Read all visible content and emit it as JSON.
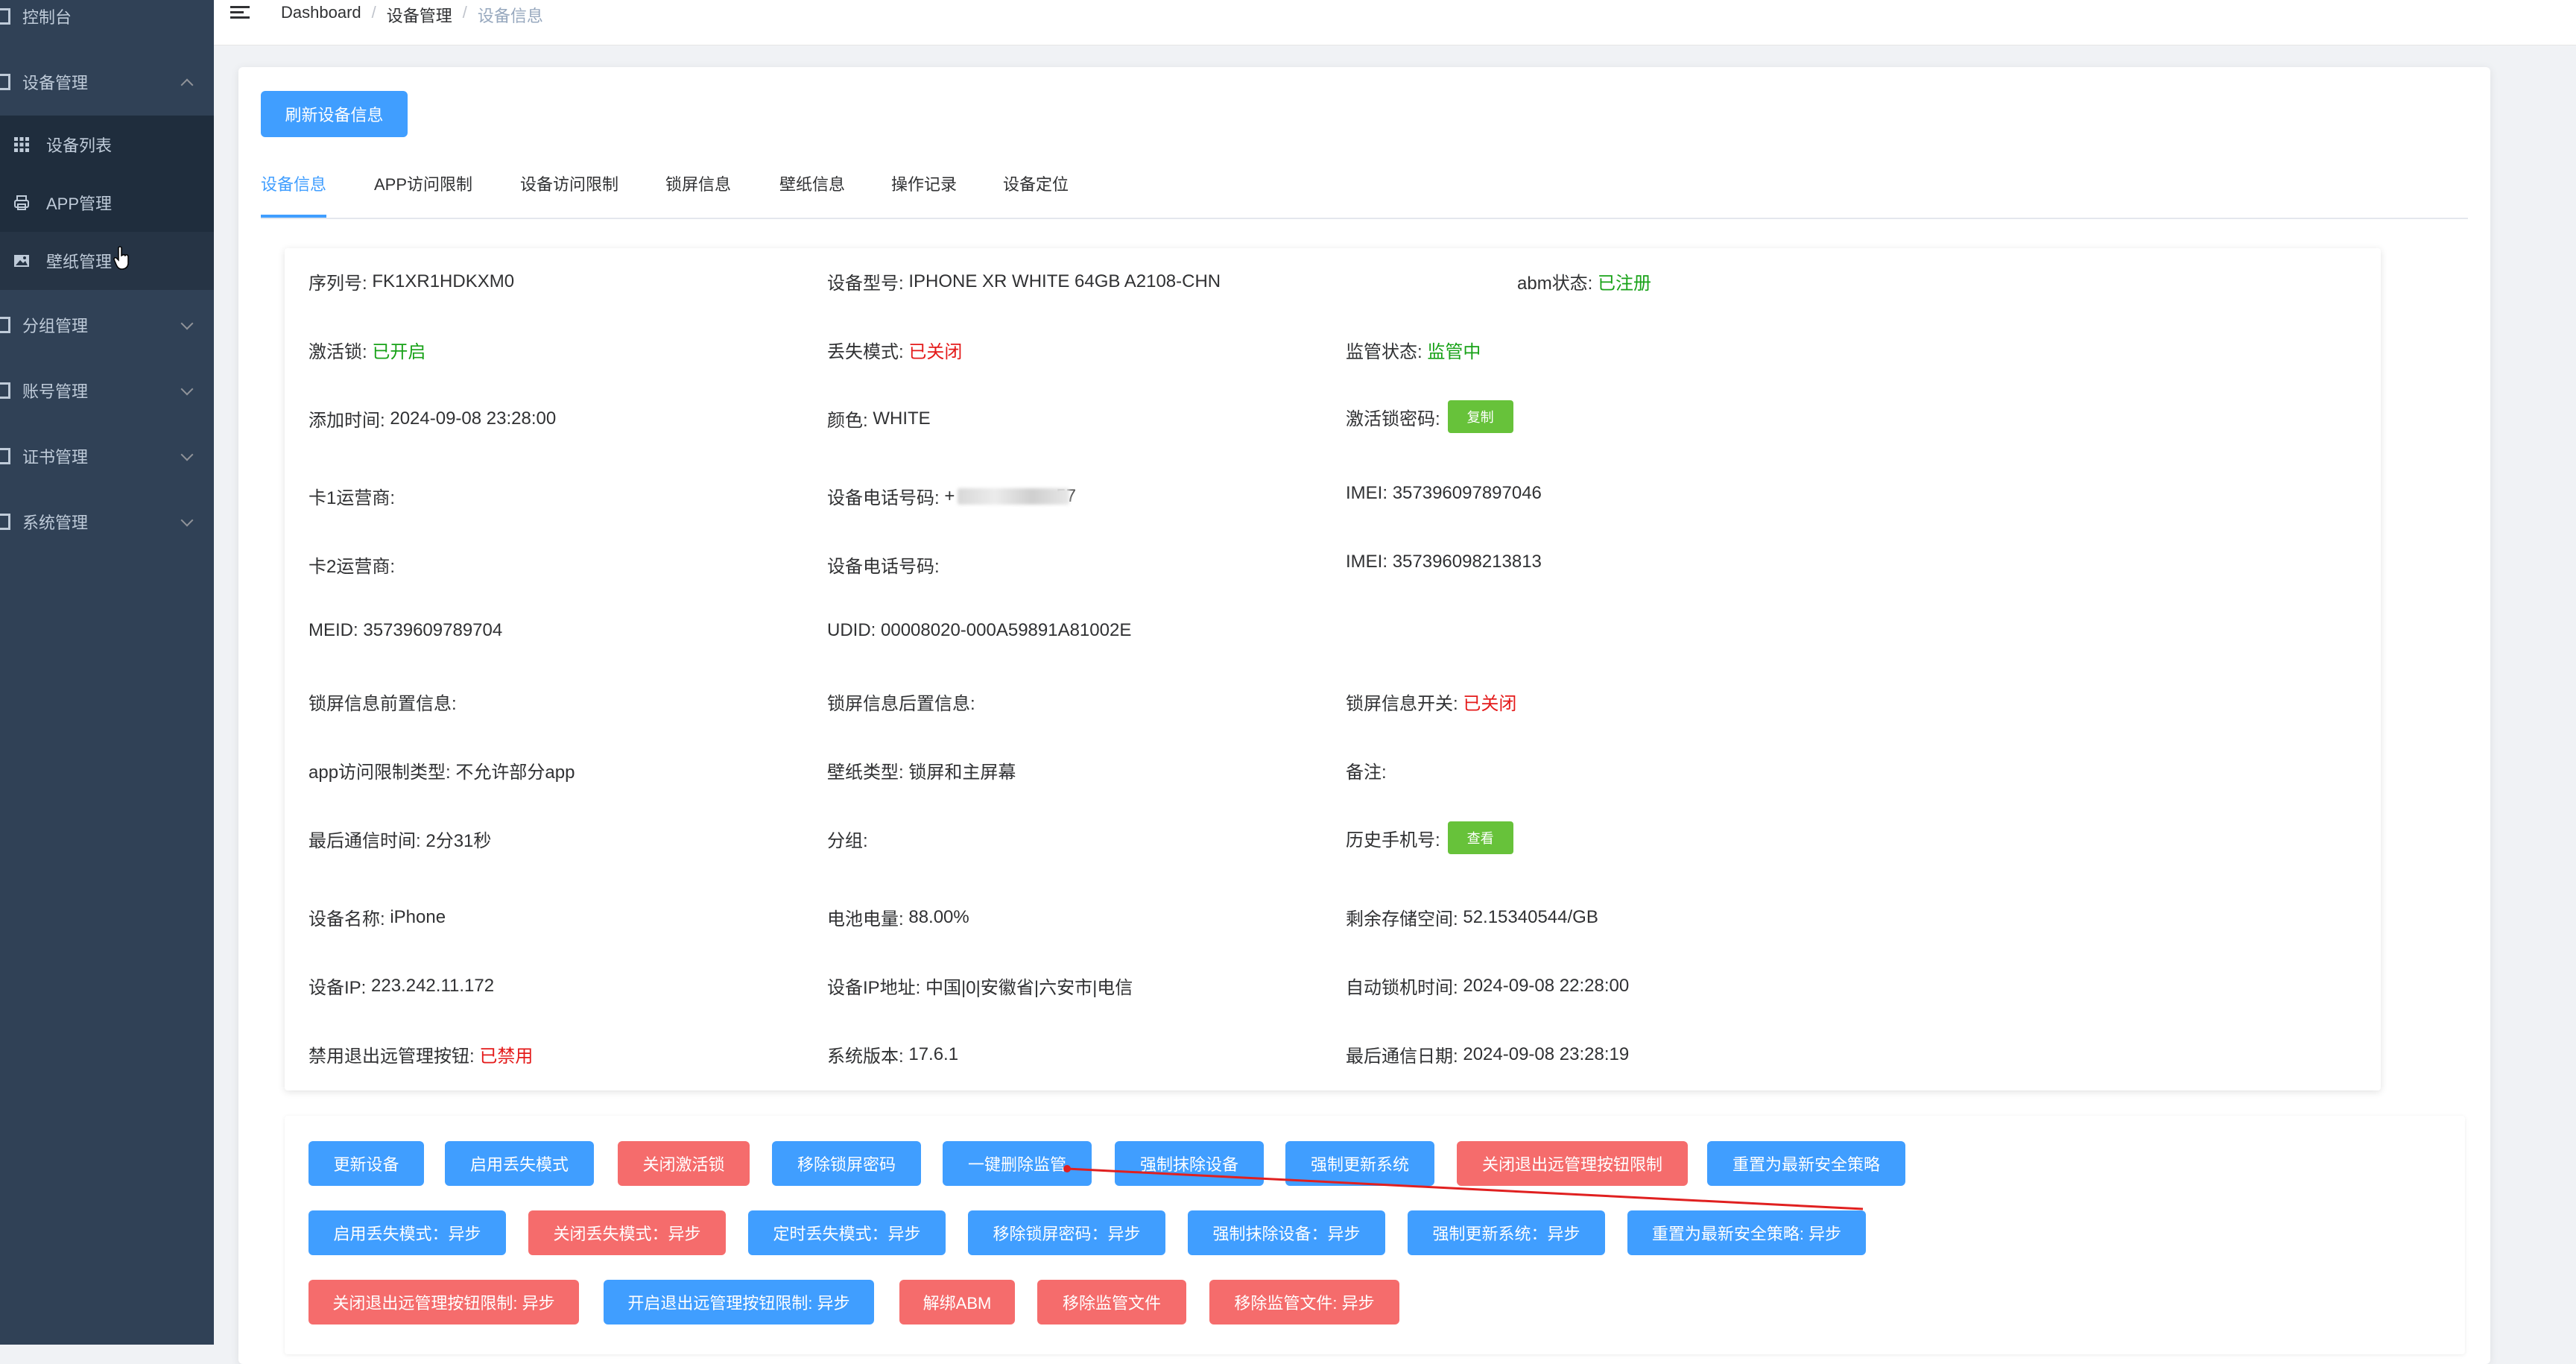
{
  "sidebar": {
    "dashboard": "控制台",
    "device_mgmt": "设备管理",
    "device_list": "设备列表",
    "app_mgmt": "APP管理",
    "wallpaper_mgmt": "壁纸管理",
    "group_mgmt": "分组管理",
    "account_mgmt": "账号管理",
    "cert_mgmt": "证书管理",
    "system_mgmt": "系统管理"
  },
  "breadcrumb": {
    "root": "Dashboard",
    "sep": "/",
    "parent": "设备管理",
    "current": "设备信息"
  },
  "toolbar": {
    "refresh_label": "刷新设备信息"
  },
  "tabs": [
    "设备信息",
    "APP访问限制",
    "设备访问限制",
    "锁屏信息",
    "壁纸信息",
    "操作记录",
    "设备定位"
  ],
  "info": {
    "serial_label": "序列号:",
    "serial": "FK1XR1HDKXM0",
    "model_label": "设备型号:",
    "model": "IPHONE XR WHITE 64GB A2108-CHN",
    "abm_label": "abm状态:",
    "abm": "已注册",
    "activation_lock_label": "激活锁:",
    "activation_lock": "已开启",
    "lost_mode_label": "丢失模式:",
    "lost_mode": "已关闭",
    "supervise_label": "监管状态:",
    "supervise": "监管中",
    "added_label": "添加时间:",
    "added": "2024-09-08 23:28:00",
    "color_label": "颜色:",
    "color": "WHITE",
    "al_code_label": "激活锁密码:",
    "copy_btn": "复制",
    "carrier1_label": "卡1运营商:",
    "phone1_label": "设备电话号码:",
    "phone1_prefix": "+",
    "phone1_suffix": "57",
    "imei1_label": "IMEI:",
    "imei1": "357396097897046",
    "carrier2_label": "卡2运营商:",
    "phone2_label": "设备电话号码:",
    "imei2_label": "IMEI:",
    "imei2": "357396098213813",
    "meid_label": "MEID:",
    "meid": "35739609789704",
    "udid_label": "UDID:",
    "udid": "00008020-000A59891A81002E",
    "lock_front_label": "锁屏信息前置信息:",
    "lock_back_label": "锁屏信息后置信息:",
    "lock_switch_label": "锁屏信息开关:",
    "lock_switch": "已关闭",
    "app_limit_label": "app访问限制类型:",
    "app_limit": "不允许部分app",
    "wallpaper_type_label": "壁纸类型:",
    "wallpaper_type": "锁屏和主屏幕",
    "remark_label": "备注:",
    "last_comm_label": "最后通信时间:",
    "last_comm": "2分31秒",
    "group_label": "分组:",
    "history_phone_label": "历史手机号:",
    "view_btn": "查看",
    "device_name_label": "设备名称:",
    "device_name": "iPhone",
    "battery_label": "电池电量:",
    "battery": "88.00%",
    "storage_label": "剩余存储空间:",
    "storage": "52.15340544/GB",
    "ip_label": "设备IP:",
    "ip": "223.242.11.172",
    "ip_addr_label": "设备IP地址:",
    "ip_addr": "中国|0|安徽省|六安市|电信",
    "auto_lock_label": "自动锁机时间:",
    "auto_lock": "2024-09-08 22:28:00",
    "exit_btn_label": "禁用退出远管理按钮:",
    "exit_btn": "已禁用",
    "os_label": "系统版本:",
    "os": "17.6.1",
    "last_date_label": "最后通信日期:",
    "last_date": "2024-09-08 23:28:19"
  },
  "actions": {
    "row1": [
      "更新设备",
      "启用丢失模式",
      "关闭激活锁",
      "移除锁屏密码",
      "一键删除监管",
      "强制抹除设备",
      "强制更新系统",
      "关闭退出远管理按钮限制",
      "重置为最新安全策略"
    ],
    "row2": [
      "启用丢失模式：异步",
      "关闭丢失模式：异步",
      "定时丢失模式：异步",
      "移除锁屏密码：异步",
      "强制抹除设备：异步",
      "强制更新系统：异步",
      "重置为最新安全策略: 异步"
    ],
    "row3": [
      "关闭退出远管理按钮限制: 异步",
      "开启退出远管理按钮限制: 异步",
      "解绑ABM",
      "移除监管文件",
      "移除监管文件: 异步"
    ]
  },
  "colors": {
    "primary": "#409eff",
    "danger": "#f56c6c",
    "success": "#67c23a",
    "sidebar": "#304156"
  }
}
